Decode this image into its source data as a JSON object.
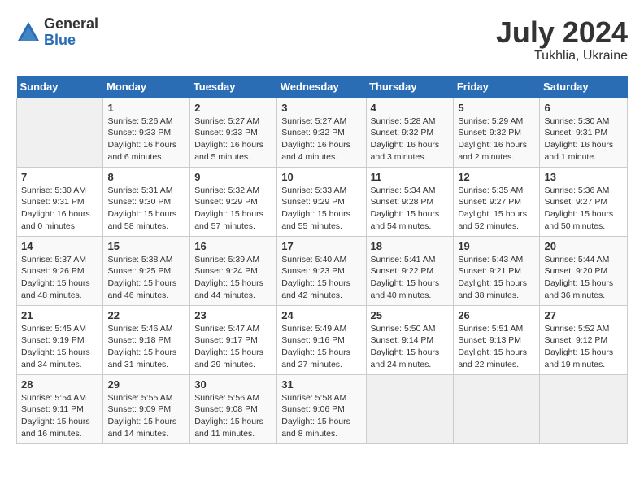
{
  "logo": {
    "general": "General",
    "blue": "Blue"
  },
  "header": {
    "month_year": "July 2024",
    "location": "Tukhlia, Ukraine"
  },
  "days_of_week": [
    "Sunday",
    "Monday",
    "Tuesday",
    "Wednesday",
    "Thursday",
    "Friday",
    "Saturday"
  ],
  "weeks": [
    [
      {
        "day": "",
        "info": ""
      },
      {
        "day": "1",
        "info": "Sunrise: 5:26 AM\nSunset: 9:33 PM\nDaylight: 16 hours\nand 6 minutes."
      },
      {
        "day": "2",
        "info": "Sunrise: 5:27 AM\nSunset: 9:33 PM\nDaylight: 16 hours\nand 5 minutes."
      },
      {
        "day": "3",
        "info": "Sunrise: 5:27 AM\nSunset: 9:32 PM\nDaylight: 16 hours\nand 4 minutes."
      },
      {
        "day": "4",
        "info": "Sunrise: 5:28 AM\nSunset: 9:32 PM\nDaylight: 16 hours\nand 3 minutes."
      },
      {
        "day": "5",
        "info": "Sunrise: 5:29 AM\nSunset: 9:32 PM\nDaylight: 16 hours\nand 2 minutes."
      },
      {
        "day": "6",
        "info": "Sunrise: 5:30 AM\nSunset: 9:31 PM\nDaylight: 16 hours\nand 1 minute."
      }
    ],
    [
      {
        "day": "7",
        "info": "Sunrise: 5:30 AM\nSunset: 9:31 PM\nDaylight: 16 hours\nand 0 minutes."
      },
      {
        "day": "8",
        "info": "Sunrise: 5:31 AM\nSunset: 9:30 PM\nDaylight: 15 hours\nand 58 minutes."
      },
      {
        "day": "9",
        "info": "Sunrise: 5:32 AM\nSunset: 9:29 PM\nDaylight: 15 hours\nand 57 minutes."
      },
      {
        "day": "10",
        "info": "Sunrise: 5:33 AM\nSunset: 9:29 PM\nDaylight: 15 hours\nand 55 minutes."
      },
      {
        "day": "11",
        "info": "Sunrise: 5:34 AM\nSunset: 9:28 PM\nDaylight: 15 hours\nand 54 minutes."
      },
      {
        "day": "12",
        "info": "Sunrise: 5:35 AM\nSunset: 9:27 PM\nDaylight: 15 hours\nand 52 minutes."
      },
      {
        "day": "13",
        "info": "Sunrise: 5:36 AM\nSunset: 9:27 PM\nDaylight: 15 hours\nand 50 minutes."
      }
    ],
    [
      {
        "day": "14",
        "info": "Sunrise: 5:37 AM\nSunset: 9:26 PM\nDaylight: 15 hours\nand 48 minutes."
      },
      {
        "day": "15",
        "info": "Sunrise: 5:38 AM\nSunset: 9:25 PM\nDaylight: 15 hours\nand 46 minutes."
      },
      {
        "day": "16",
        "info": "Sunrise: 5:39 AM\nSunset: 9:24 PM\nDaylight: 15 hours\nand 44 minutes."
      },
      {
        "day": "17",
        "info": "Sunrise: 5:40 AM\nSunset: 9:23 PM\nDaylight: 15 hours\nand 42 minutes."
      },
      {
        "day": "18",
        "info": "Sunrise: 5:41 AM\nSunset: 9:22 PM\nDaylight: 15 hours\nand 40 minutes."
      },
      {
        "day": "19",
        "info": "Sunrise: 5:43 AM\nSunset: 9:21 PM\nDaylight: 15 hours\nand 38 minutes."
      },
      {
        "day": "20",
        "info": "Sunrise: 5:44 AM\nSunset: 9:20 PM\nDaylight: 15 hours\nand 36 minutes."
      }
    ],
    [
      {
        "day": "21",
        "info": "Sunrise: 5:45 AM\nSunset: 9:19 PM\nDaylight: 15 hours\nand 34 minutes."
      },
      {
        "day": "22",
        "info": "Sunrise: 5:46 AM\nSunset: 9:18 PM\nDaylight: 15 hours\nand 31 minutes."
      },
      {
        "day": "23",
        "info": "Sunrise: 5:47 AM\nSunset: 9:17 PM\nDaylight: 15 hours\nand 29 minutes."
      },
      {
        "day": "24",
        "info": "Sunrise: 5:49 AM\nSunset: 9:16 PM\nDaylight: 15 hours\nand 27 minutes."
      },
      {
        "day": "25",
        "info": "Sunrise: 5:50 AM\nSunset: 9:14 PM\nDaylight: 15 hours\nand 24 minutes."
      },
      {
        "day": "26",
        "info": "Sunrise: 5:51 AM\nSunset: 9:13 PM\nDaylight: 15 hours\nand 22 minutes."
      },
      {
        "day": "27",
        "info": "Sunrise: 5:52 AM\nSunset: 9:12 PM\nDaylight: 15 hours\nand 19 minutes."
      }
    ],
    [
      {
        "day": "28",
        "info": "Sunrise: 5:54 AM\nSunset: 9:11 PM\nDaylight: 15 hours\nand 16 minutes."
      },
      {
        "day": "29",
        "info": "Sunrise: 5:55 AM\nSunset: 9:09 PM\nDaylight: 15 hours\nand 14 minutes."
      },
      {
        "day": "30",
        "info": "Sunrise: 5:56 AM\nSunset: 9:08 PM\nDaylight: 15 hours\nand 11 minutes."
      },
      {
        "day": "31",
        "info": "Sunrise: 5:58 AM\nSunset: 9:06 PM\nDaylight: 15 hours\nand 8 minutes."
      },
      {
        "day": "",
        "info": ""
      },
      {
        "day": "",
        "info": ""
      },
      {
        "day": "",
        "info": ""
      }
    ]
  ]
}
